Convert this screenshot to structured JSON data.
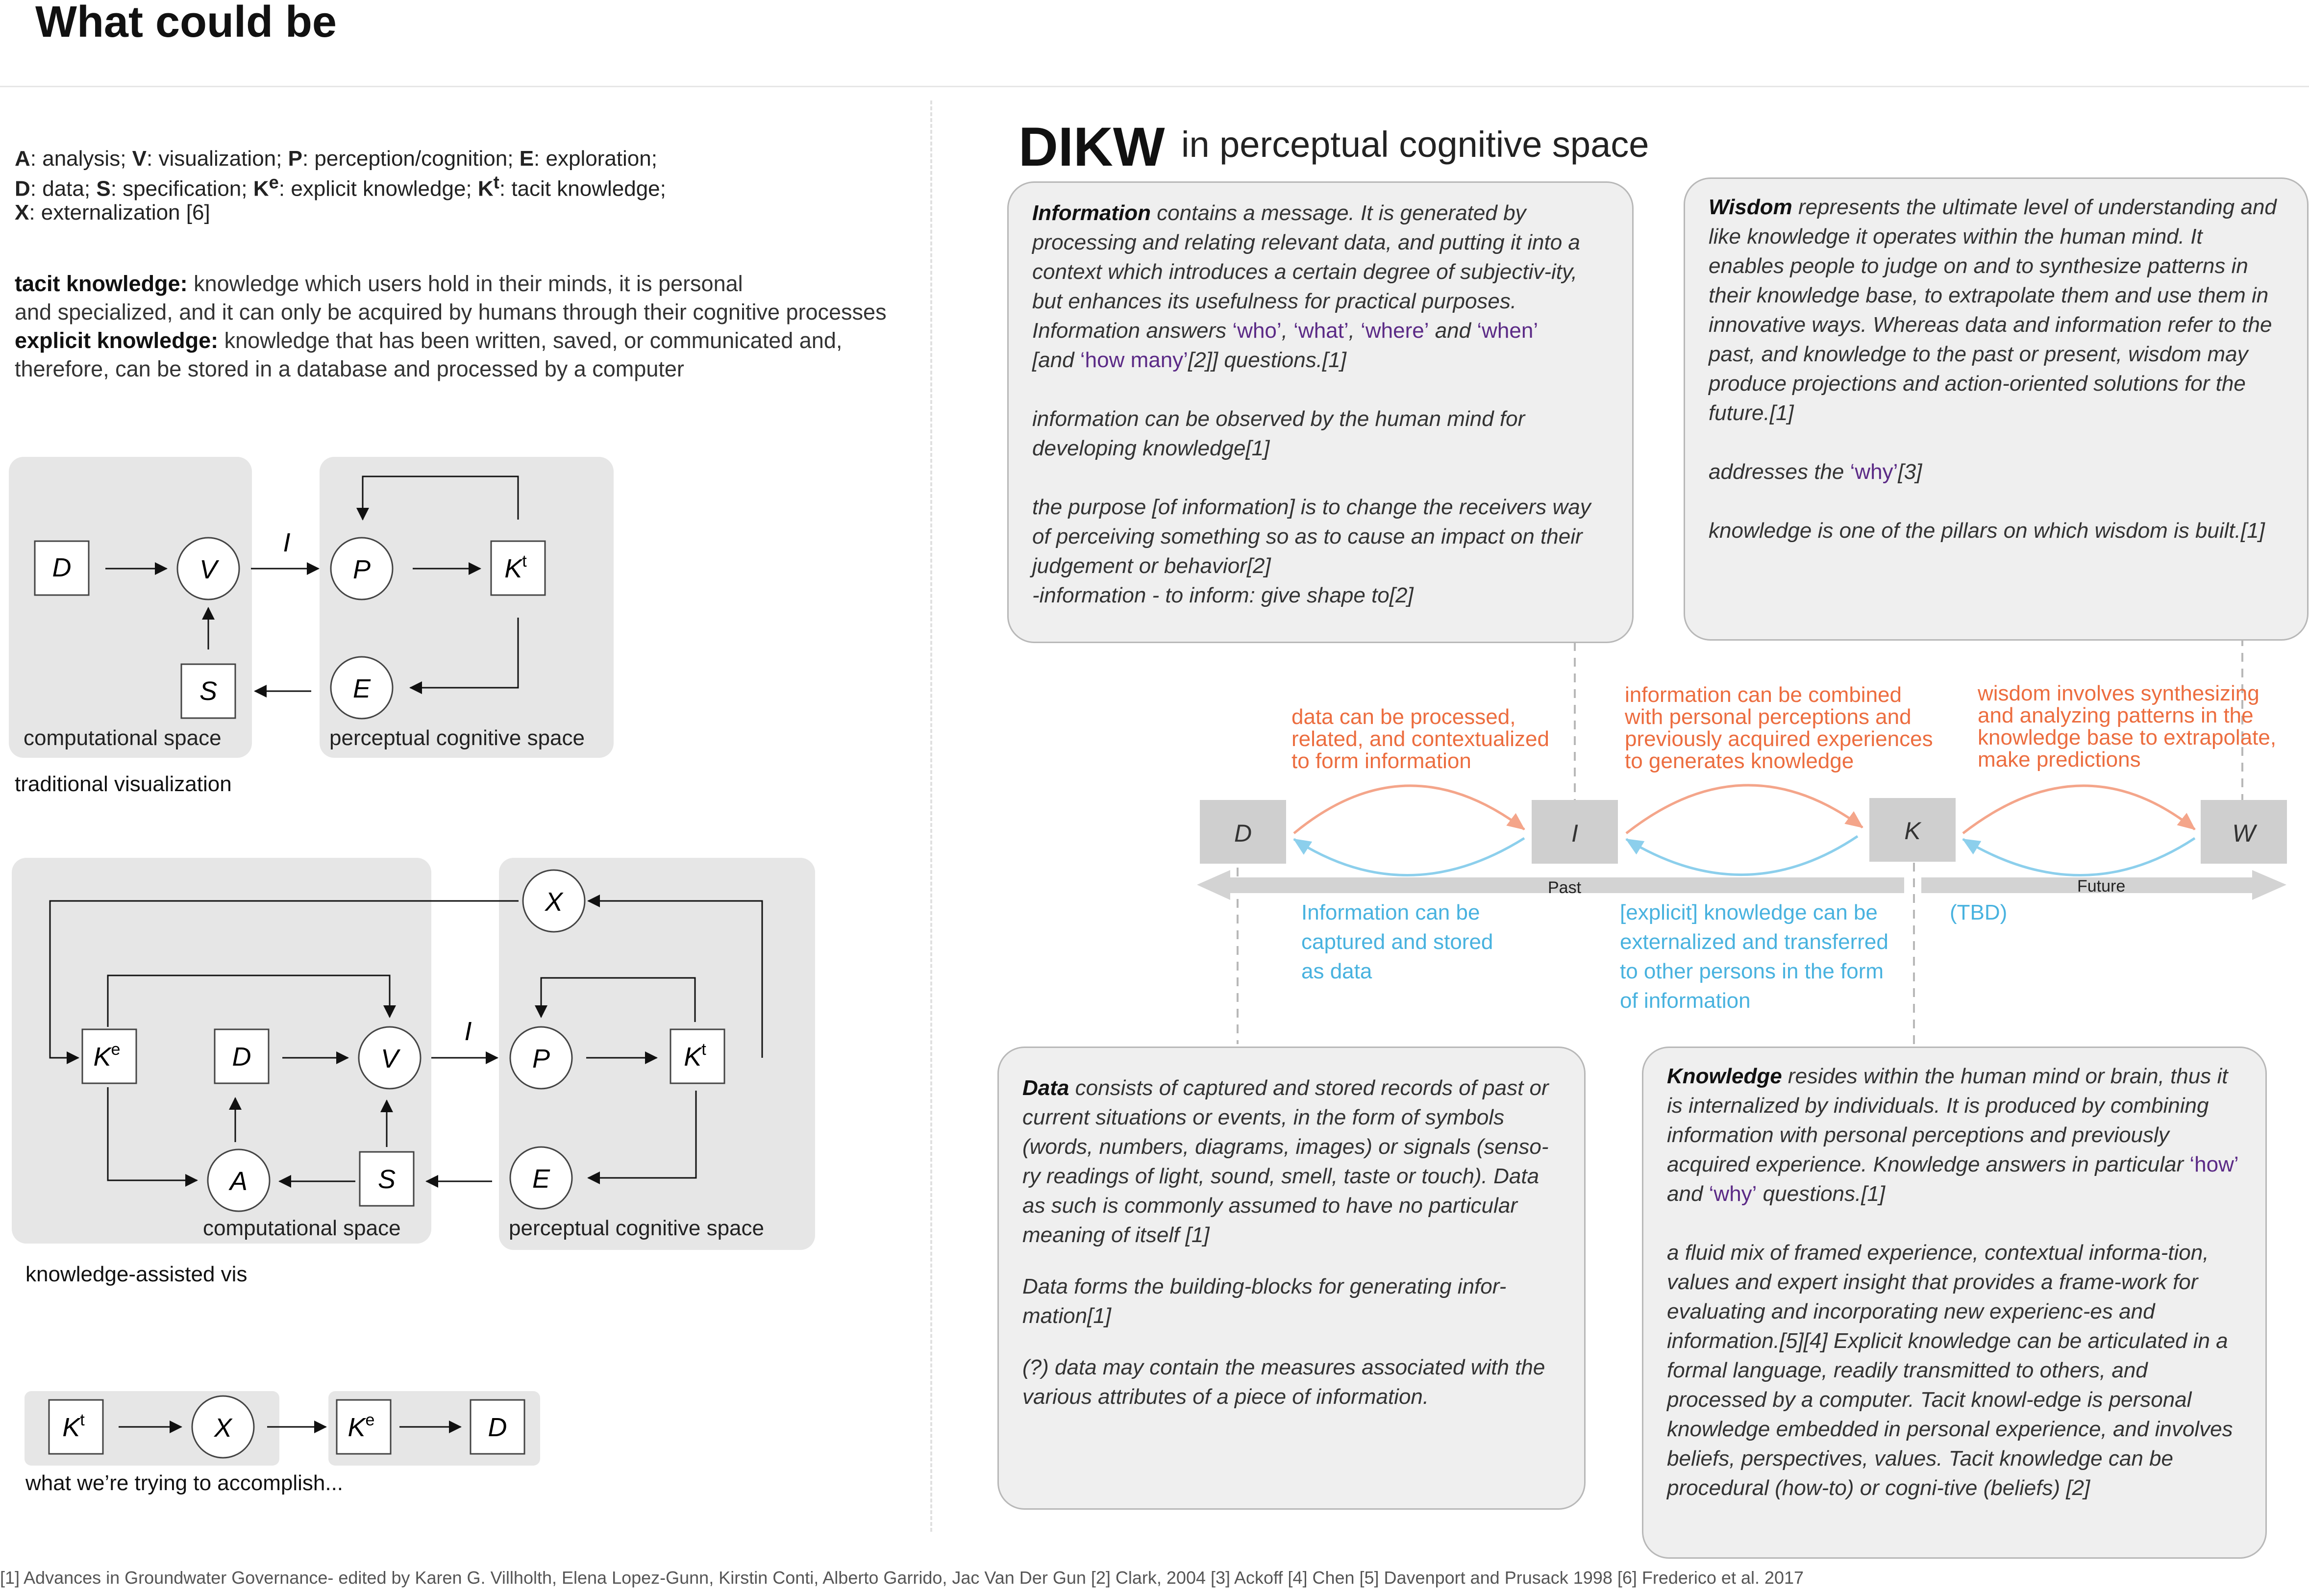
{
  "page": {
    "title": "What could be"
  },
  "legend": {
    "line1": [
      {
        "k": "A",
        "v": ": analysis; "
      },
      {
        "k": "V",
        "v": ": visualization; "
      },
      {
        "k": "P",
        "v": ": perception/cognition; "
      },
      {
        "k": "E",
        "v": ": exploration;"
      }
    ],
    "line2": [
      {
        "k": "D",
        "v": ": data; "
      },
      {
        "k": "S",
        "v": ": specification; "
      },
      {
        "k": "K",
        "sup": "e",
        "v": ": explicit knowledge; "
      },
      {
        "k": "K",
        "sup": "t",
        "v": ": tacit knowledge;"
      }
    ],
    "line3": [
      {
        "k": "X",
        "v": ": externalization [6]"
      }
    ]
  },
  "definitions": {
    "tacit_term": "tacit knowledge:",
    "tacit_line1": " knowledge which users hold in their minds, it is personal",
    "tacit_line2": "and specialized, and it can only be acquired by humans through their cognitive processes",
    "explicit_term": "explicit knowledge:",
    "explicit_line1": " knowledge that has been written, saved, or communicated and,",
    "explicit_line2": "therefore, can be stored in a database and processed by a computer"
  },
  "diagram1": {
    "computational_label": "computational space",
    "perceptual_label": "perceptual cognitive space",
    "caption": "traditional visualization",
    "nodes": {
      "d": "D",
      "v": "V",
      "s": "S",
      "p": "P",
      "kt": "K",
      "e": "E",
      "i": "I"
    }
  },
  "diagram2": {
    "computational_label": "computational space",
    "perceptual_label": "perceptual cognitive space",
    "caption": "knowledge-assisted vis",
    "nodes": {
      "x": "X",
      "ke": "K",
      "d": "D",
      "v": "V",
      "a": "A",
      "s": "S",
      "p": "P",
      "kt": "K",
      "e": "E",
      "i": "I"
    }
  },
  "diagram3": {
    "caption": "what we’re trying to accomplish...",
    "nodes": {
      "kt": "K",
      "x": "X",
      "ke": "K",
      "d": "D"
    }
  },
  "dikw": {
    "title": "DIKW",
    "subtitle": "in perceptual cognitive space",
    "information_card": {
      "term": "Information",
      "p1_a": " contains a message. It is generated by processing and relating relevant data, and putting it into a context which introduces a certain degree of subjectiv-ity, but enhances its usefulness for practical purposes. Information answers ",
      "q_who": "‘who’",
      "q_what": "‘what’",
      "q_where": "‘where’",
      "and": " and ",
      "q_when": "‘when’",
      "p1_b": "[and ",
      "q_howmany": "‘how many’",
      "p1_c": "[2]] questions.[1]",
      "p2": "information can be observed by the human mind for developing knowledge[1]",
      "p3": "the purpose [of information] is to change the receivers way of perceiving something so as to cause an impact on their judgement or behavior[2]",
      "p4": "-information - to inform: give shape to[2]"
    },
    "wisdom_card": {
      "term": "Wisdom",
      "p1": " represents the ultimate level of understanding and like knowledge it operates within the human mind. It enables people to judge on and to synthesize patterns in their knowledge base, to extrapolate them and use them in innovative ways. Whereas data and information refer to the past, and knowledge to the past or present, wisdom may produce projections and action-oriented solutions for the future.[1]",
      "p2_a": "addresses the ",
      "q_why": "‘why’",
      "p2_b": "[3]",
      "p3": "knowledge is one of the pillars on which wisdom is built.[1]"
    },
    "data_card": {
      "term": "Data",
      "p1": " consists of captured and stored records of past or current situations or events, in the form of symbols (words, numbers, diagrams, images) or signals (senso-ry readings of light, sound, smell, taste or touch). Data as such is commonly assumed to have no particular meaning of itself [1]",
      "p2": "Data forms the building-blocks for generating infor-mation[1]",
      "p3": "(?) data may contain the measures associated with the various attributes of a piece of information."
    },
    "knowledge_card": {
      "term": "Knowledge",
      "p1_a": " resides within the human mind or brain, thus it is internalized by individuals. It is produced by combining information with personal perceptions and previously acquired experience. Knowledge answers in particular ",
      "q_how": "‘how’",
      "and": " and ",
      "q_why": "‘why’",
      "p1_b": " questions.[1]",
      "p2": "a fluid mix of framed experience, contextual informa-tion, values and expert insight that provides a frame-work for evaluating and incorporating new experienc-es and information.[5][4] Explicit knowledge can be articulated in a formal language, readily transmitted to others, and processed by a computer. Tacit knowl-edge is personal knowledge embedded in personal experience, and involves beliefs, perspectives, values. Tacit knowledge can be procedural (how-to) or cogni-tive (beliefs) [2]"
    },
    "boxes": {
      "d": "D",
      "i": "I",
      "k": "K",
      "w": "W"
    },
    "forward": {
      "di": [
        "data can be processed,",
        "related, and contextualized",
        "to form information"
      ],
      "ik": [
        "information can be combined",
        "with personal perceptions and",
        "previously acquired experiences",
        "to generates knowledge"
      ],
      "kw": [
        "wisdom involves synthesizing",
        "and analyzing patterns in the",
        "knowledge base to extrapolate,",
        "make predictions"
      ]
    },
    "backward": {
      "id": [
        "Information can be",
        "captured and stored",
        "as data"
      ],
      "ki": [
        "[explicit] knowledge can be",
        "externalized and transferred",
        "to other persons in the form",
        "of information"
      ],
      "wk": [
        "(TBD)"
      ]
    },
    "timeline": {
      "past": "Past",
      "future": "Future"
    }
  },
  "footnote": "[1] Advances in Groundwater Governance- edited by Karen G. Villholth, Elena Lopez-Gunn, Kirstin Conti, Alberto Garrido, Jac Van Der Gun [2] Clark, 2004 [3] Ackoff [4] Chen [5] Davenport and Prusack 1998 [6] Frederico et al. 2017",
  "colors": {
    "forward_arrow": "#f4a58a",
    "backward_arrow": "#8ccfec",
    "forward_text": "#ec6d3f",
    "backward_text": "#48b2df",
    "question_words": "#5b2a86",
    "panel": "#e6e6e6",
    "dikw_box": "#cfcfcf"
  }
}
